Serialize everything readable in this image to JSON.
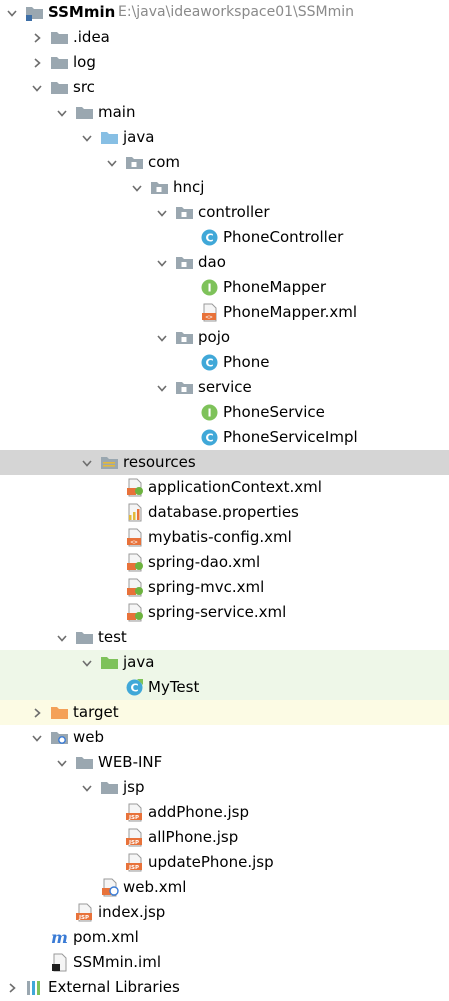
{
  "tree": [
    {
      "id": "ssmmin",
      "label": "SSMmin",
      "path": "E:\\java\\ideaworkspace01\\SSMmin",
      "depth": 0,
      "arrow": "down",
      "icon": "module-folder-icon",
      "bold": true
    },
    {
      "id": "idea",
      "label": ".idea",
      "depth": 1,
      "arrow": "right",
      "icon": "folder-icon"
    },
    {
      "id": "log",
      "label": "log",
      "depth": 1,
      "arrow": "right",
      "icon": "folder-icon"
    },
    {
      "id": "src",
      "label": "src",
      "depth": 1,
      "arrow": "down",
      "icon": "folder-icon"
    },
    {
      "id": "main",
      "label": "main",
      "depth": 2,
      "arrow": "down",
      "icon": "folder-icon"
    },
    {
      "id": "java",
      "label": "java",
      "depth": 3,
      "arrow": "down",
      "icon": "source-folder-icon"
    },
    {
      "id": "com",
      "label": "com",
      "depth": 4,
      "arrow": "down",
      "icon": "package-icon"
    },
    {
      "id": "hncj",
      "label": "hncj",
      "depth": 5,
      "arrow": "down",
      "icon": "package-icon"
    },
    {
      "id": "controller",
      "label": "controller",
      "depth": 6,
      "arrow": "down",
      "icon": "package-icon"
    },
    {
      "id": "phonecontroller",
      "label": "PhoneController",
      "depth": 7,
      "arrow": "none",
      "icon": "class-icon"
    },
    {
      "id": "dao",
      "label": "dao",
      "depth": 6,
      "arrow": "down",
      "icon": "package-icon"
    },
    {
      "id": "phonemapper",
      "label": "PhoneMapper",
      "depth": 7,
      "arrow": "none",
      "icon": "interface-icon"
    },
    {
      "id": "phonemapper-xml",
      "label": "PhoneMapper.xml",
      "depth": 7,
      "arrow": "none",
      "icon": "xml-file-icon"
    },
    {
      "id": "pojo",
      "label": "pojo",
      "depth": 6,
      "arrow": "down",
      "icon": "package-icon"
    },
    {
      "id": "phone",
      "label": "Phone",
      "depth": 7,
      "arrow": "none",
      "icon": "class-icon"
    },
    {
      "id": "service",
      "label": "service",
      "depth": 6,
      "arrow": "down",
      "icon": "package-icon"
    },
    {
      "id": "phoneservice",
      "label": "PhoneService",
      "depth": 7,
      "arrow": "none",
      "icon": "interface-icon"
    },
    {
      "id": "phoneserviceimpl",
      "label": "PhoneServiceImpl",
      "depth": 7,
      "arrow": "none",
      "icon": "class-icon"
    },
    {
      "id": "resources",
      "label": "resources",
      "depth": 3,
      "arrow": "down",
      "icon": "resources-folder-icon",
      "selected": true
    },
    {
      "id": "applicationcontext",
      "label": "applicationContext.xml",
      "depth": 4,
      "arrow": "none",
      "icon": "spring-xml-icon"
    },
    {
      "id": "database-properties",
      "label": "database.properties",
      "depth": 4,
      "arrow": "none",
      "icon": "properties-file-icon"
    },
    {
      "id": "mybatis-config",
      "label": "mybatis-config.xml",
      "depth": 4,
      "arrow": "none",
      "icon": "xml-file-icon"
    },
    {
      "id": "spring-dao",
      "label": "spring-dao.xml",
      "depth": 4,
      "arrow": "none",
      "icon": "spring-xml-icon"
    },
    {
      "id": "spring-mvc",
      "label": "spring-mvc.xml",
      "depth": 4,
      "arrow": "none",
      "icon": "spring-xml-icon"
    },
    {
      "id": "spring-service",
      "label": "spring-service.xml",
      "depth": 4,
      "arrow": "none",
      "icon": "spring-xml-icon"
    },
    {
      "id": "test",
      "label": "test",
      "depth": 2,
      "arrow": "down",
      "icon": "folder-icon"
    },
    {
      "id": "test-java",
      "label": "java",
      "depth": 3,
      "arrow": "down",
      "icon": "test-source-folder-icon",
      "bg": "test"
    },
    {
      "id": "mytest",
      "label": "MyTest",
      "depth": 4,
      "arrow": "none",
      "icon": "test-class-icon",
      "bg": "test"
    },
    {
      "id": "target",
      "label": "target",
      "depth": 1,
      "arrow": "right",
      "icon": "excluded-folder-icon",
      "bg": "excl"
    },
    {
      "id": "web",
      "label": "web",
      "depth": 1,
      "arrow": "down",
      "icon": "web-folder-icon"
    },
    {
      "id": "web-inf",
      "label": "WEB-INF",
      "depth": 2,
      "arrow": "down",
      "icon": "folder-icon"
    },
    {
      "id": "jsp",
      "label": "jsp",
      "depth": 3,
      "arrow": "down",
      "icon": "folder-icon"
    },
    {
      "id": "addphone",
      "label": "addPhone.jsp",
      "depth": 4,
      "arrow": "none",
      "icon": "jsp-file-icon"
    },
    {
      "id": "allphone",
      "label": "allPhone.jsp",
      "depth": 4,
      "arrow": "none",
      "icon": "jsp-file-icon"
    },
    {
      "id": "updatephone",
      "label": "updatePhone.jsp",
      "depth": 4,
      "arrow": "none",
      "icon": "jsp-file-icon"
    },
    {
      "id": "web-xml",
      "label": "web.xml",
      "depth": 3,
      "arrow": "none",
      "icon": "web-xml-icon"
    },
    {
      "id": "index-jsp",
      "label": "index.jsp",
      "depth": 2,
      "arrow": "none",
      "icon": "jsp-file-icon"
    },
    {
      "id": "pom-xml",
      "label": "pom.xml",
      "depth": 1,
      "arrow": "none",
      "icon": "maven-icon"
    },
    {
      "id": "ssmmin-iml",
      "label": "SSMmin.iml",
      "depth": 1,
      "arrow": "none",
      "icon": "iml-file-icon"
    },
    {
      "id": "external-libraries",
      "label": "External Libraries",
      "depth": 0,
      "arrow": "right",
      "icon": "libraries-icon"
    }
  ],
  "colors": {
    "selection": "#d5d5d5",
    "test_bg": "#eef7e8",
    "excluded_bg": "#fcfbe4",
    "folder": "#9aa7b0",
    "source_folder": "#87bfe4",
    "test_folder": "#7ec25a",
    "excluded_folder": "#f4a158",
    "class_icon": "#40a8d8",
    "interface_icon": "#7ec25a",
    "xml_orange": "#e8723a",
    "spring_green": "#6db33f"
  }
}
